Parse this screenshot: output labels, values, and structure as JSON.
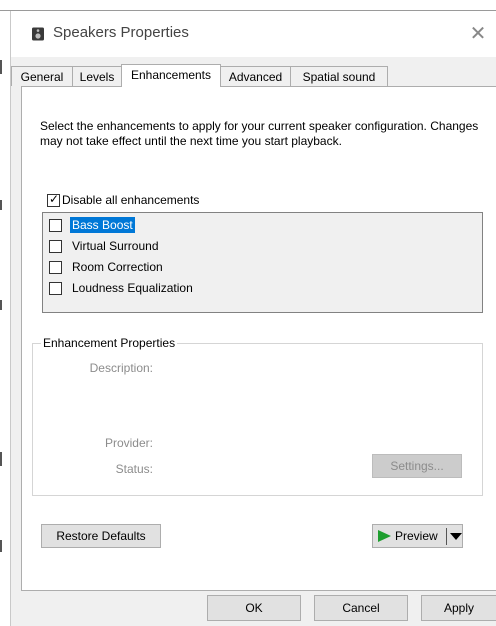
{
  "window": {
    "title": "Speakers Properties",
    "close_icon": "close-icon",
    "app_icon": "speaker-icon"
  },
  "tabs": [
    {
      "label": "General",
      "active": false
    },
    {
      "label": "Levels",
      "active": false
    },
    {
      "label": "Enhancements",
      "active": true
    },
    {
      "label": "Advanced",
      "active": false
    },
    {
      "label": "Spatial sound",
      "active": false
    }
  ],
  "enhancements": {
    "description": "Select the enhancements to apply for your current speaker configuration. Changes may not take effect until the next time you start playback.",
    "disable_all_label": "Disable all enhancements",
    "disable_all_checked": true,
    "items": [
      {
        "label": "Bass Boost",
        "checked": false,
        "selected": true
      },
      {
        "label": "Virtual Surround",
        "checked": false,
        "selected": false
      },
      {
        "label": "Room Correction",
        "checked": false,
        "selected": false
      },
      {
        "label": "Loudness Equalization",
        "checked": false,
        "selected": false
      }
    ]
  },
  "properties": {
    "group_title": "Enhancement Properties",
    "description_label": "Description:",
    "provider_label": "Provider:",
    "status_label": "Status:",
    "settings_label": "Settings..."
  },
  "actions": {
    "restore_label": "Restore Defaults",
    "preview_label": "Preview",
    "play_icon": "play-icon",
    "dropdown_icon": "chevron-down-icon"
  },
  "footer": {
    "ok_label": "OK",
    "cancel_label": "Cancel",
    "apply_label": "Apply"
  },
  "colors": {
    "selection": "#0078d7",
    "play": "#1e9e2f",
    "dialog_bg": "#f0f0f0"
  }
}
